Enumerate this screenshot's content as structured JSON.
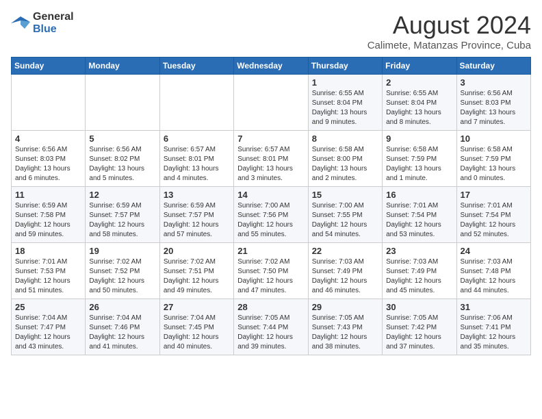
{
  "logo": {
    "line1": "General",
    "line2": "Blue"
  },
  "title": "August 2024",
  "subtitle": "Calimete, Matanzas Province, Cuba",
  "weekdays": [
    "Sunday",
    "Monday",
    "Tuesday",
    "Wednesday",
    "Thursday",
    "Friday",
    "Saturday"
  ],
  "weeks": [
    [
      {
        "day": "",
        "info": ""
      },
      {
        "day": "",
        "info": ""
      },
      {
        "day": "",
        "info": ""
      },
      {
        "day": "",
        "info": ""
      },
      {
        "day": "1",
        "info": "Sunrise: 6:55 AM\nSunset: 8:04 PM\nDaylight: 13 hours\nand 9 minutes."
      },
      {
        "day": "2",
        "info": "Sunrise: 6:55 AM\nSunset: 8:04 PM\nDaylight: 13 hours\nand 8 minutes."
      },
      {
        "day": "3",
        "info": "Sunrise: 6:56 AM\nSunset: 8:03 PM\nDaylight: 13 hours\nand 7 minutes."
      }
    ],
    [
      {
        "day": "4",
        "info": "Sunrise: 6:56 AM\nSunset: 8:03 PM\nDaylight: 13 hours\nand 6 minutes."
      },
      {
        "day": "5",
        "info": "Sunrise: 6:56 AM\nSunset: 8:02 PM\nDaylight: 13 hours\nand 5 minutes."
      },
      {
        "day": "6",
        "info": "Sunrise: 6:57 AM\nSunset: 8:01 PM\nDaylight: 13 hours\nand 4 minutes."
      },
      {
        "day": "7",
        "info": "Sunrise: 6:57 AM\nSunset: 8:01 PM\nDaylight: 13 hours\nand 3 minutes."
      },
      {
        "day": "8",
        "info": "Sunrise: 6:58 AM\nSunset: 8:00 PM\nDaylight: 13 hours\nand 2 minutes."
      },
      {
        "day": "9",
        "info": "Sunrise: 6:58 AM\nSunset: 7:59 PM\nDaylight: 13 hours\nand 1 minute."
      },
      {
        "day": "10",
        "info": "Sunrise: 6:58 AM\nSunset: 7:59 PM\nDaylight: 13 hours\nand 0 minutes."
      }
    ],
    [
      {
        "day": "11",
        "info": "Sunrise: 6:59 AM\nSunset: 7:58 PM\nDaylight: 12 hours\nand 59 minutes."
      },
      {
        "day": "12",
        "info": "Sunrise: 6:59 AM\nSunset: 7:57 PM\nDaylight: 12 hours\nand 58 minutes."
      },
      {
        "day": "13",
        "info": "Sunrise: 6:59 AM\nSunset: 7:57 PM\nDaylight: 12 hours\nand 57 minutes."
      },
      {
        "day": "14",
        "info": "Sunrise: 7:00 AM\nSunset: 7:56 PM\nDaylight: 12 hours\nand 55 minutes."
      },
      {
        "day": "15",
        "info": "Sunrise: 7:00 AM\nSunset: 7:55 PM\nDaylight: 12 hours\nand 54 minutes."
      },
      {
        "day": "16",
        "info": "Sunrise: 7:01 AM\nSunset: 7:54 PM\nDaylight: 12 hours\nand 53 minutes."
      },
      {
        "day": "17",
        "info": "Sunrise: 7:01 AM\nSunset: 7:54 PM\nDaylight: 12 hours\nand 52 minutes."
      }
    ],
    [
      {
        "day": "18",
        "info": "Sunrise: 7:01 AM\nSunset: 7:53 PM\nDaylight: 12 hours\nand 51 minutes."
      },
      {
        "day": "19",
        "info": "Sunrise: 7:02 AM\nSunset: 7:52 PM\nDaylight: 12 hours\nand 50 minutes."
      },
      {
        "day": "20",
        "info": "Sunrise: 7:02 AM\nSunset: 7:51 PM\nDaylight: 12 hours\nand 49 minutes."
      },
      {
        "day": "21",
        "info": "Sunrise: 7:02 AM\nSunset: 7:50 PM\nDaylight: 12 hours\nand 47 minutes."
      },
      {
        "day": "22",
        "info": "Sunrise: 7:03 AM\nSunset: 7:49 PM\nDaylight: 12 hours\nand 46 minutes."
      },
      {
        "day": "23",
        "info": "Sunrise: 7:03 AM\nSunset: 7:49 PM\nDaylight: 12 hours\nand 45 minutes."
      },
      {
        "day": "24",
        "info": "Sunrise: 7:03 AM\nSunset: 7:48 PM\nDaylight: 12 hours\nand 44 minutes."
      }
    ],
    [
      {
        "day": "25",
        "info": "Sunrise: 7:04 AM\nSunset: 7:47 PM\nDaylight: 12 hours\nand 43 minutes."
      },
      {
        "day": "26",
        "info": "Sunrise: 7:04 AM\nSunset: 7:46 PM\nDaylight: 12 hours\nand 41 minutes."
      },
      {
        "day": "27",
        "info": "Sunrise: 7:04 AM\nSunset: 7:45 PM\nDaylight: 12 hours\nand 40 minutes."
      },
      {
        "day": "28",
        "info": "Sunrise: 7:05 AM\nSunset: 7:44 PM\nDaylight: 12 hours\nand 39 minutes."
      },
      {
        "day": "29",
        "info": "Sunrise: 7:05 AM\nSunset: 7:43 PM\nDaylight: 12 hours\nand 38 minutes."
      },
      {
        "day": "30",
        "info": "Sunrise: 7:05 AM\nSunset: 7:42 PM\nDaylight: 12 hours\nand 37 minutes."
      },
      {
        "day": "31",
        "info": "Sunrise: 7:06 AM\nSunset: 7:41 PM\nDaylight: 12 hours\nand 35 minutes."
      }
    ]
  ]
}
